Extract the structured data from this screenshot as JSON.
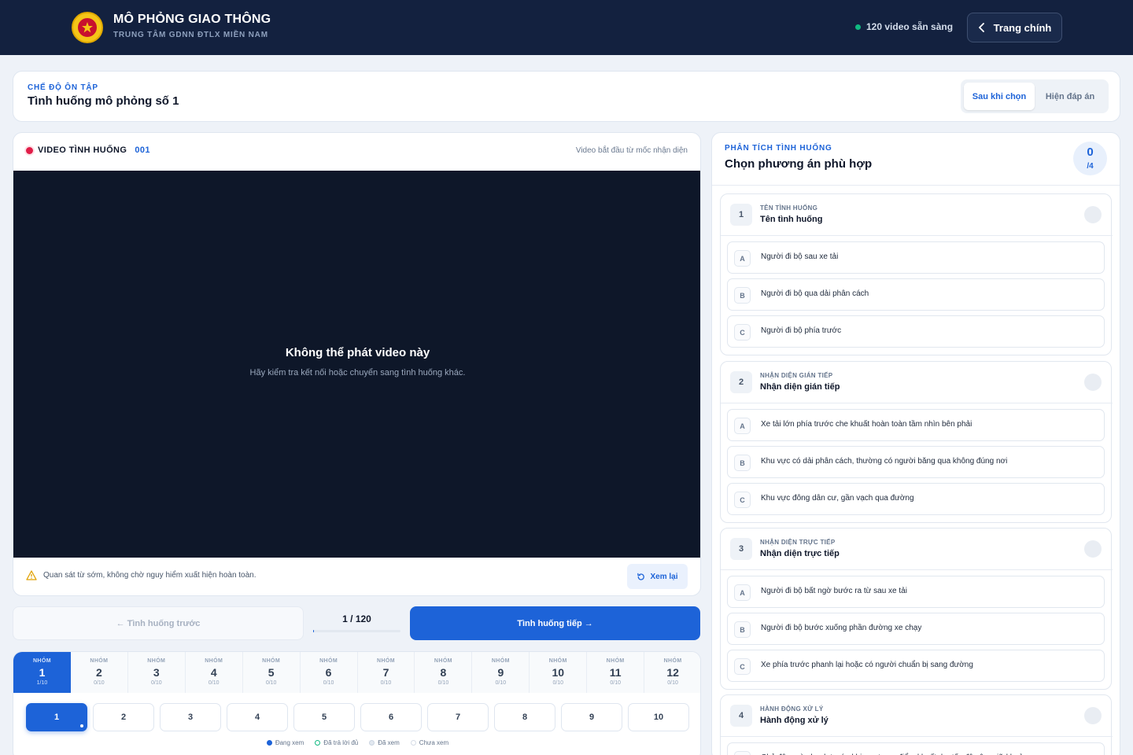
{
  "header": {
    "brand_title": "MÔ PHỎNG GIAO THÔNG",
    "brand_subtitle": "TRUNG TÂM GDNN ĐTLX MIỀN NAM",
    "ready_text": "120 video sẵn sàng",
    "home_label": "Trang chính"
  },
  "mode": {
    "label": "CHẾ ĐỘ ÔN TẬP",
    "title": "Tình huống mô phỏng số 1",
    "toggle": [
      "Sau khi chọn",
      "Hiện đáp án"
    ],
    "toggle_selected": "Sau khi chọn"
  },
  "video": {
    "label": "VIDEO TÌNH HUỐNG",
    "number": "001",
    "note": "Video bắt đầu từ mốc nhận diện",
    "error_title": "Không thể phát video này",
    "error_sub": "Hãy kiểm tra kết nối hoặc chuyển sang tình huống khác.",
    "tip": "Quan sát từ sớm, không chờ nguy hiểm xuất hiện hoàn toàn.",
    "replay_label": "Xem lại"
  },
  "nav": {
    "prev_label": "← Tình huống trước",
    "counter": "1 / 120",
    "progress_fraction": 0.0083,
    "next_label": "Tình huống tiếp →"
  },
  "groups": {
    "group_word": "NHÓM",
    "tabs": [
      {
        "num": "1",
        "progress": "1/10"
      },
      {
        "num": "2",
        "progress": "0/10"
      },
      {
        "num": "3",
        "progress": "0/10"
      },
      {
        "num": "4",
        "progress": "0/10"
      },
      {
        "num": "5",
        "progress": "0/10"
      },
      {
        "num": "6",
        "progress": "0/10"
      },
      {
        "num": "7",
        "progress": "0/10"
      },
      {
        "num": "8",
        "progress": "0/10"
      },
      {
        "num": "9",
        "progress": "0/10"
      },
      {
        "num": "10",
        "progress": "0/10"
      },
      {
        "num": "11",
        "progress": "0/10"
      },
      {
        "num": "12",
        "progress": "0/10"
      }
    ],
    "questions": [
      "1",
      "2",
      "3",
      "4",
      "5",
      "6",
      "7",
      "8",
      "9",
      "10"
    ],
    "legend": [
      "Đang xem",
      "Đã trả lời đủ",
      "Đã xem",
      "Chưa xem"
    ]
  },
  "panel": {
    "label": "PHÂN TÍCH TÌNH HUỐNG",
    "title": "Chọn phương án phù hợp",
    "score": "0",
    "score_total": "/4",
    "questions": [
      {
        "num": "1",
        "category": "TÊN TÌNH HUỐNG",
        "name": "Tên tình huống",
        "options": [
          {
            "letter": "A",
            "text": "Người đi bộ sau xe tải"
          },
          {
            "letter": "B",
            "text": "Người đi bộ qua dải phân cách"
          },
          {
            "letter": "C",
            "text": "Người đi bộ phía trước"
          }
        ]
      },
      {
        "num": "2",
        "category": "NHẬN DIỆN GIÁN TIẾP",
        "name": "Nhận diện gián tiếp",
        "options": [
          {
            "letter": "A",
            "text": "Xe tải lớn phía trước che khuất hoàn toàn tầm nhìn bên phải"
          },
          {
            "letter": "B",
            "text": "Khu vực có dải phân cách, thường có người băng qua không đúng nơi"
          },
          {
            "letter": "C",
            "text": "Khu vực đông dân cư, gần vạch qua đường"
          }
        ]
      },
      {
        "num": "3",
        "category": "NHẬN DIỆN TRỰC TIẾP",
        "name": "Nhận diện trực tiếp",
        "options": [
          {
            "letter": "A",
            "text": "Người đi bộ bất ngờ bước ra từ sau xe tải"
          },
          {
            "letter": "B",
            "text": "Người đi bộ bước xuống phần đường xe chạy"
          },
          {
            "letter": "C",
            "text": "Xe phía trước phanh lại hoặc có người chuẩn bị sang đường"
          }
        ]
      },
      {
        "num": "4",
        "category": "HÀNH ĐỘNG XỬ LÝ",
        "name": "Hành động xử lý",
        "options": [
          {
            "letter": "A",
            "text": "Chủ động rà phanh trước khi vượt qua điểm khuất, hạ tốc độ sâu, giữ khoảng"
          }
        ]
      }
    ]
  },
  "colors": {
    "accent": "#1d63d8",
    "topbar": "#13213f",
    "video_bg": "#0e1729",
    "ready_dot": "#10b981",
    "rec_dot": "#e11d48"
  }
}
